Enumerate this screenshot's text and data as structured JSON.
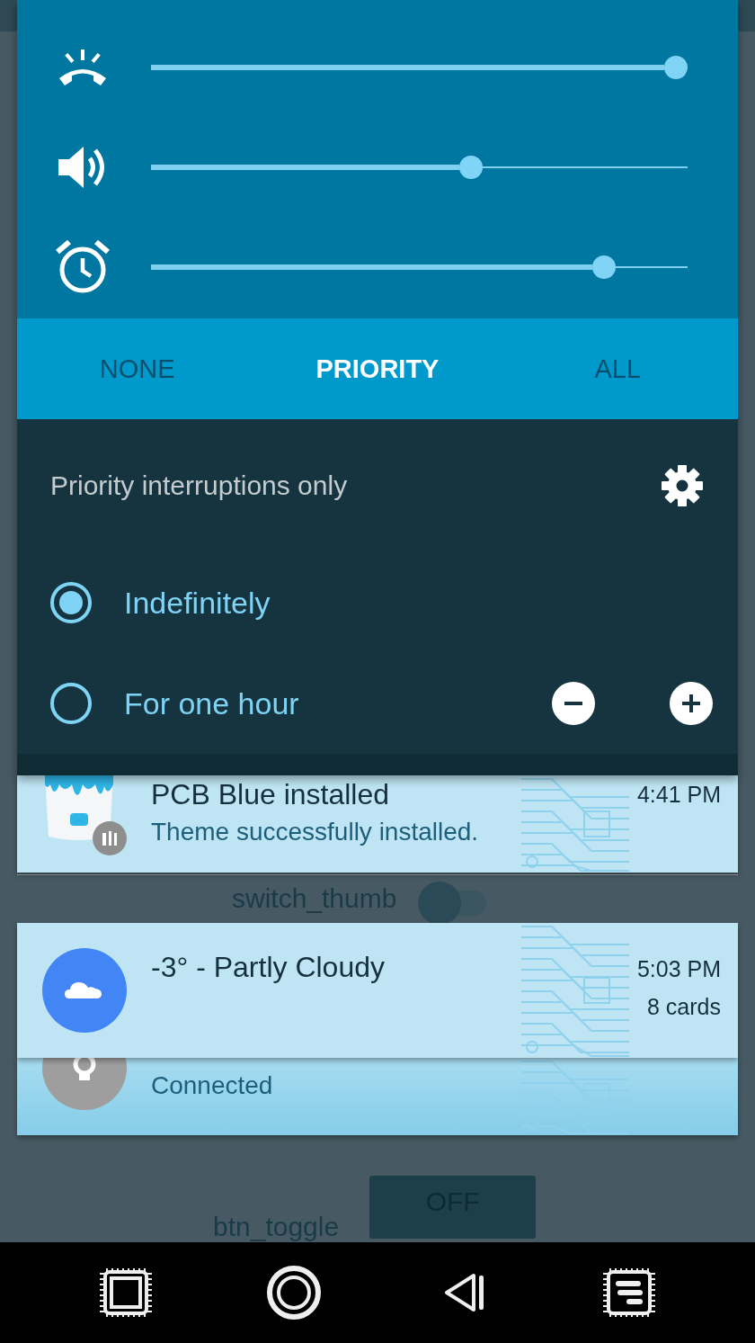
{
  "volume_panel": {
    "sliders": [
      {
        "kind": "ringer",
        "level": 1
      },
      {
        "kind": "media",
        "level": 0.6
      },
      {
        "kind": "alarm",
        "level": 0.86
      }
    ],
    "tabs": [
      {
        "label": "NONE",
        "selected": false
      },
      {
        "label": "PRIORITY",
        "selected": true
      },
      {
        "label": "ALL",
        "selected": false
      }
    ],
    "mode_title": "Priority interruptions only",
    "durations": [
      {
        "label": "Indefinitely",
        "selected": true,
        "stepper": false
      },
      {
        "label": "For one hour",
        "selected": false,
        "stepper": true
      }
    ]
  },
  "notifications": [
    {
      "kind": "theme",
      "title": "PCB Blue installed",
      "text": "Theme successfully installed.",
      "time": "4:41 PM"
    },
    {
      "kind": "weather",
      "title": "-3° - Partly Cloudy",
      "time": "5:03 PM",
      "count": "8 cards"
    },
    {
      "kind": "bulb",
      "text": "Connected"
    }
  ],
  "background": {
    "switch_label": "switch_thumb",
    "toggle_label": "btn_toggle",
    "toggle_button": "OFF"
  },
  "nav_bar": [
    {
      "kind": "recent"
    },
    {
      "kind": "home"
    },
    {
      "kind": "back"
    },
    {
      "kind": "menu"
    }
  ]
}
